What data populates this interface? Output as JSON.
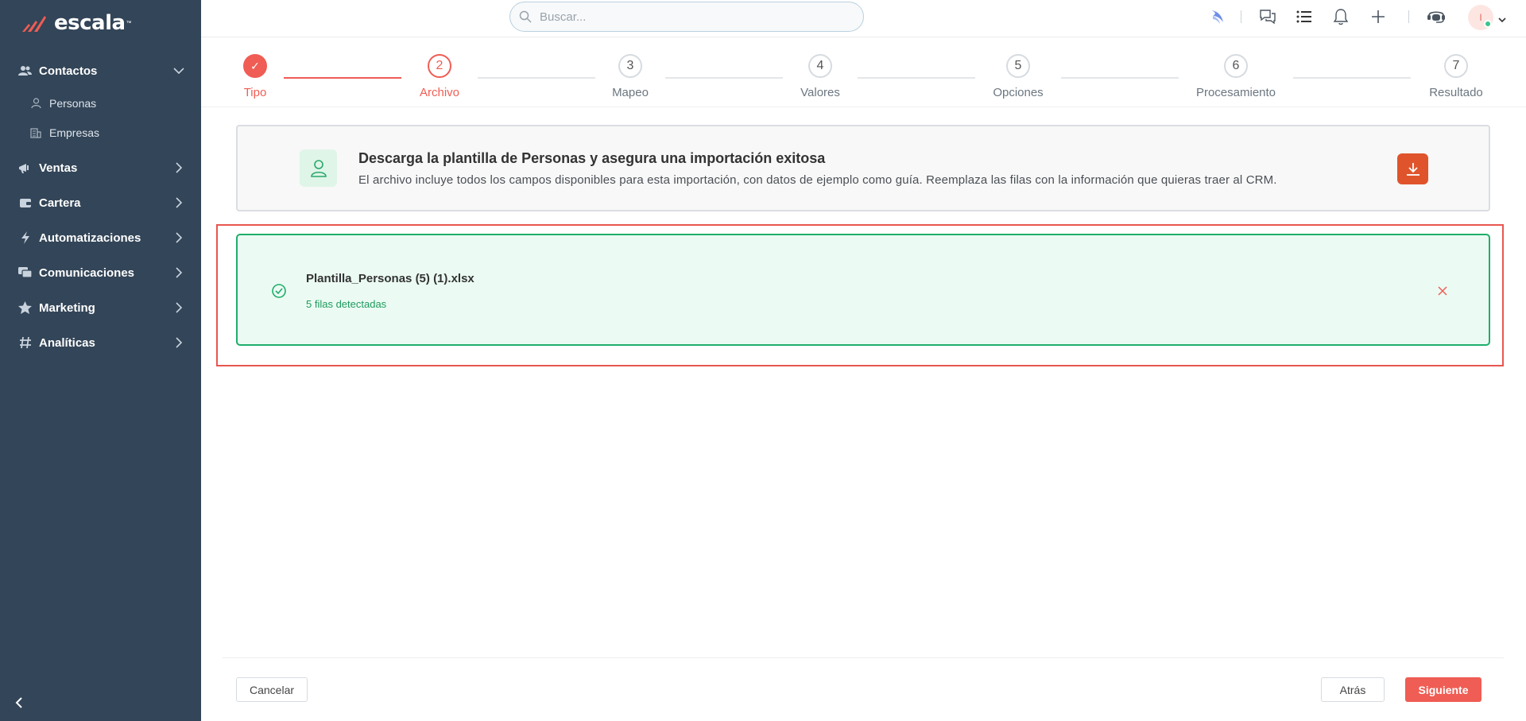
{
  "brand": {
    "name": "escala",
    "trademark": "™"
  },
  "search": {
    "placeholder": "Buscar..."
  },
  "sidebar": {
    "items": [
      {
        "label": "Contactos",
        "icon": "contacts-icon",
        "expanded": true,
        "children": [
          {
            "label": "Personas",
            "icon": "person-icon"
          },
          {
            "label": "Empresas",
            "icon": "building-icon"
          }
        ]
      },
      {
        "label": "Ventas",
        "icon": "megaphone-icon"
      },
      {
        "label": "Cartera",
        "icon": "wallet-icon"
      },
      {
        "label": "Automatizaciones",
        "icon": "bolt-icon"
      },
      {
        "label": "Comunicaciones",
        "icon": "chat-icon"
      },
      {
        "label": "Marketing",
        "icon": "star-icon"
      },
      {
        "label": "Analíticas",
        "icon": "hashtag-icon"
      }
    ]
  },
  "header": {
    "icons": [
      "bird-icon",
      "chat-bubbles-icon",
      "list-icon",
      "bell-icon",
      "plus-icon",
      "support-icon"
    ],
    "avatar_initial": "I"
  },
  "stepper": {
    "current": 2,
    "steps": [
      {
        "number": "1",
        "label": "Tipo",
        "state": "done",
        "mark": "✓"
      },
      {
        "number": "2",
        "label": "Archivo",
        "state": "active"
      },
      {
        "number": "3",
        "label": "Mapeo",
        "state": "pending"
      },
      {
        "number": "4",
        "label": "Valores",
        "state": "pending"
      },
      {
        "number": "5",
        "label": "Opciones",
        "state": "pending"
      },
      {
        "number": "6",
        "label": "Procesamiento",
        "state": "pending"
      },
      {
        "number": "7",
        "label": "Resultado",
        "state": "pending"
      }
    ]
  },
  "template_card": {
    "title": "Descarga la plantilla de Personas y asegura una importación exitosa",
    "description": "El archivo incluye todos los campos disponibles para esta importación, con datos de ejemplo como guía. Reemplaza las filas con la información que quieras traer al CRM."
  },
  "uploaded_file": {
    "name": "Plantilla_Personas (5) (1).xlsx",
    "rows_detected": "5 filas detectadas"
  },
  "footer": {
    "cancel_label": "Cancelar",
    "back_label": "Atrás",
    "next_label": "Siguiente"
  },
  "colors": {
    "sidebar_bg": "#334558",
    "accent": "#ef5d54",
    "success": "#1fae6b",
    "success_bg": "#ebfbf3",
    "download_btn": "#e0542c"
  }
}
